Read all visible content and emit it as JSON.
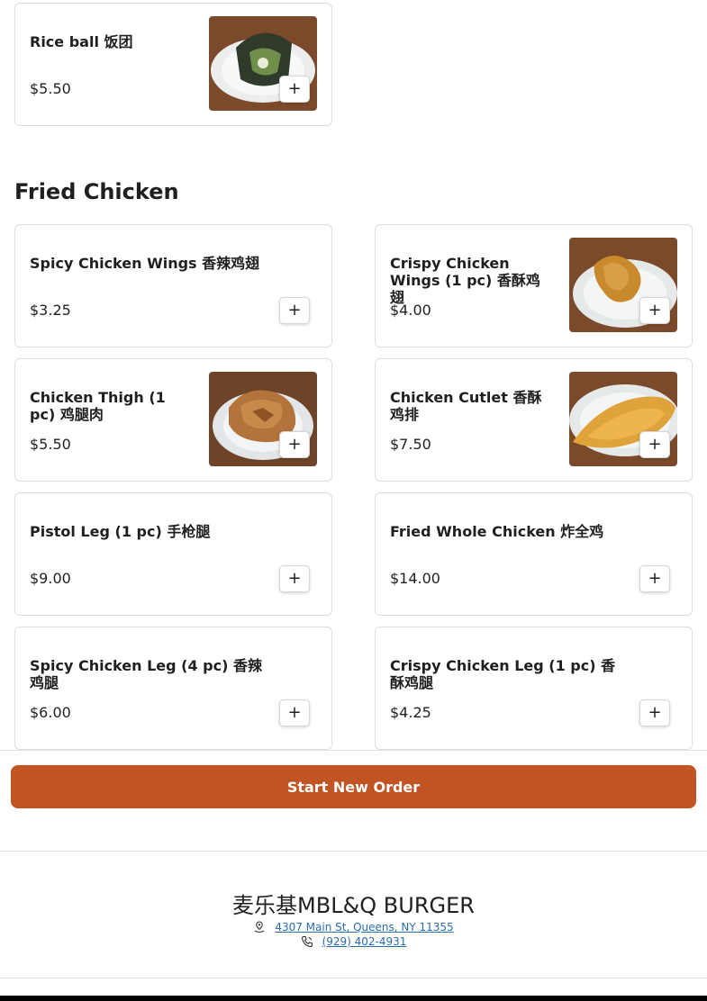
{
  "top_items": [
    {
      "name": "Rice ball 饭团",
      "price": "$5.50",
      "image": "rice-ball-photo"
    }
  ],
  "section": {
    "title": "Fried Chicken",
    "items": [
      {
        "name": "Spicy Chicken Wings 香辣鸡翅",
        "price": "$3.25"
      },
      {
        "name": "Crispy Chicken Wings (1 pc) 香酥鸡翅",
        "price": "$4.00",
        "image": "chicken-wing-photo"
      },
      {
        "name": "Chicken Thigh (1 pc) 鸡腿肉",
        "price": "$5.50",
        "image": "chicken-thigh-photo"
      },
      {
        "name": "Chicken Cutlet 香酥鸡排",
        "price": "$7.50",
        "image": "chicken-cutlet-photo"
      },
      {
        "name": "Pistol Leg (1 pc) 手枪腿",
        "price": "$9.00"
      },
      {
        "name": "Fried Whole Chicken 炸全鸡",
        "price": "$14.00"
      },
      {
        "name": "Spicy Chicken Leg (4 pc) 香辣鸡腿",
        "price": "$6.00"
      },
      {
        "name": "Crispy Chicken Leg (1 pc) 香酥鸡腿",
        "price": "$4.25"
      }
    ]
  },
  "add_label": "+",
  "cta": {
    "label": "Start New Order",
    "color": "#c25423"
  },
  "footer": {
    "store_name": "麦乐基MBL&Q BURGER",
    "address": "4307 Main St, Queens, NY 11355",
    "phone": "(929) 402-4931",
    "address_icon": "location-pin-icon",
    "phone_icon": "phone-icon"
  }
}
